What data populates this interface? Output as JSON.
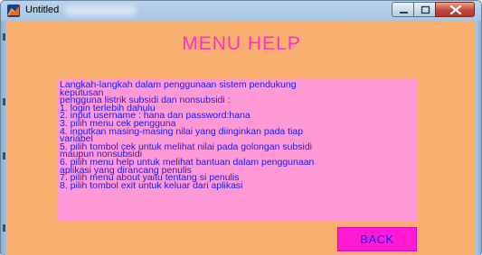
{
  "window": {
    "title": "Untitled"
  },
  "icons": {
    "app": "matlab-figure-icon",
    "minimize": "minimize-icon",
    "maximize": "maximize-icon",
    "close": "close-icon"
  },
  "colors": {
    "background": "#f7ae6f",
    "title": "#ff33cc",
    "panel": "#ff99d6",
    "text": "#1a1aee",
    "button": "#ff1ad4"
  },
  "menu": {
    "title": "MENU HELP",
    "lines": [
      "Langkah-langkah dalam penggunaan sistem pendukung",
      "keputusan",
      "pengguna listrik subsidi dan nonsubsidi :",
      "1. login terlebih dahulu",
      "2. input username : hana dan password:hana",
      "3. pilih menu cek pengguna",
      "4. inputkan masing-masing nilai yang diinginkan pada tiap",
      "variabel",
      "5. pilih tombol cek untuk melihat nilai pada golongan subsidi",
      "maupun nonsubsidi",
      "6. pilih menu help untuk melihat bantuan dalam penggunaan",
      "aplikasi yang dirancang penulis",
      "7. pilih menu about yaitu tentang si penulis",
      "8. pilih tombol exit untuk keluar dari aplikasi"
    ],
    "back_label": "BACK"
  }
}
